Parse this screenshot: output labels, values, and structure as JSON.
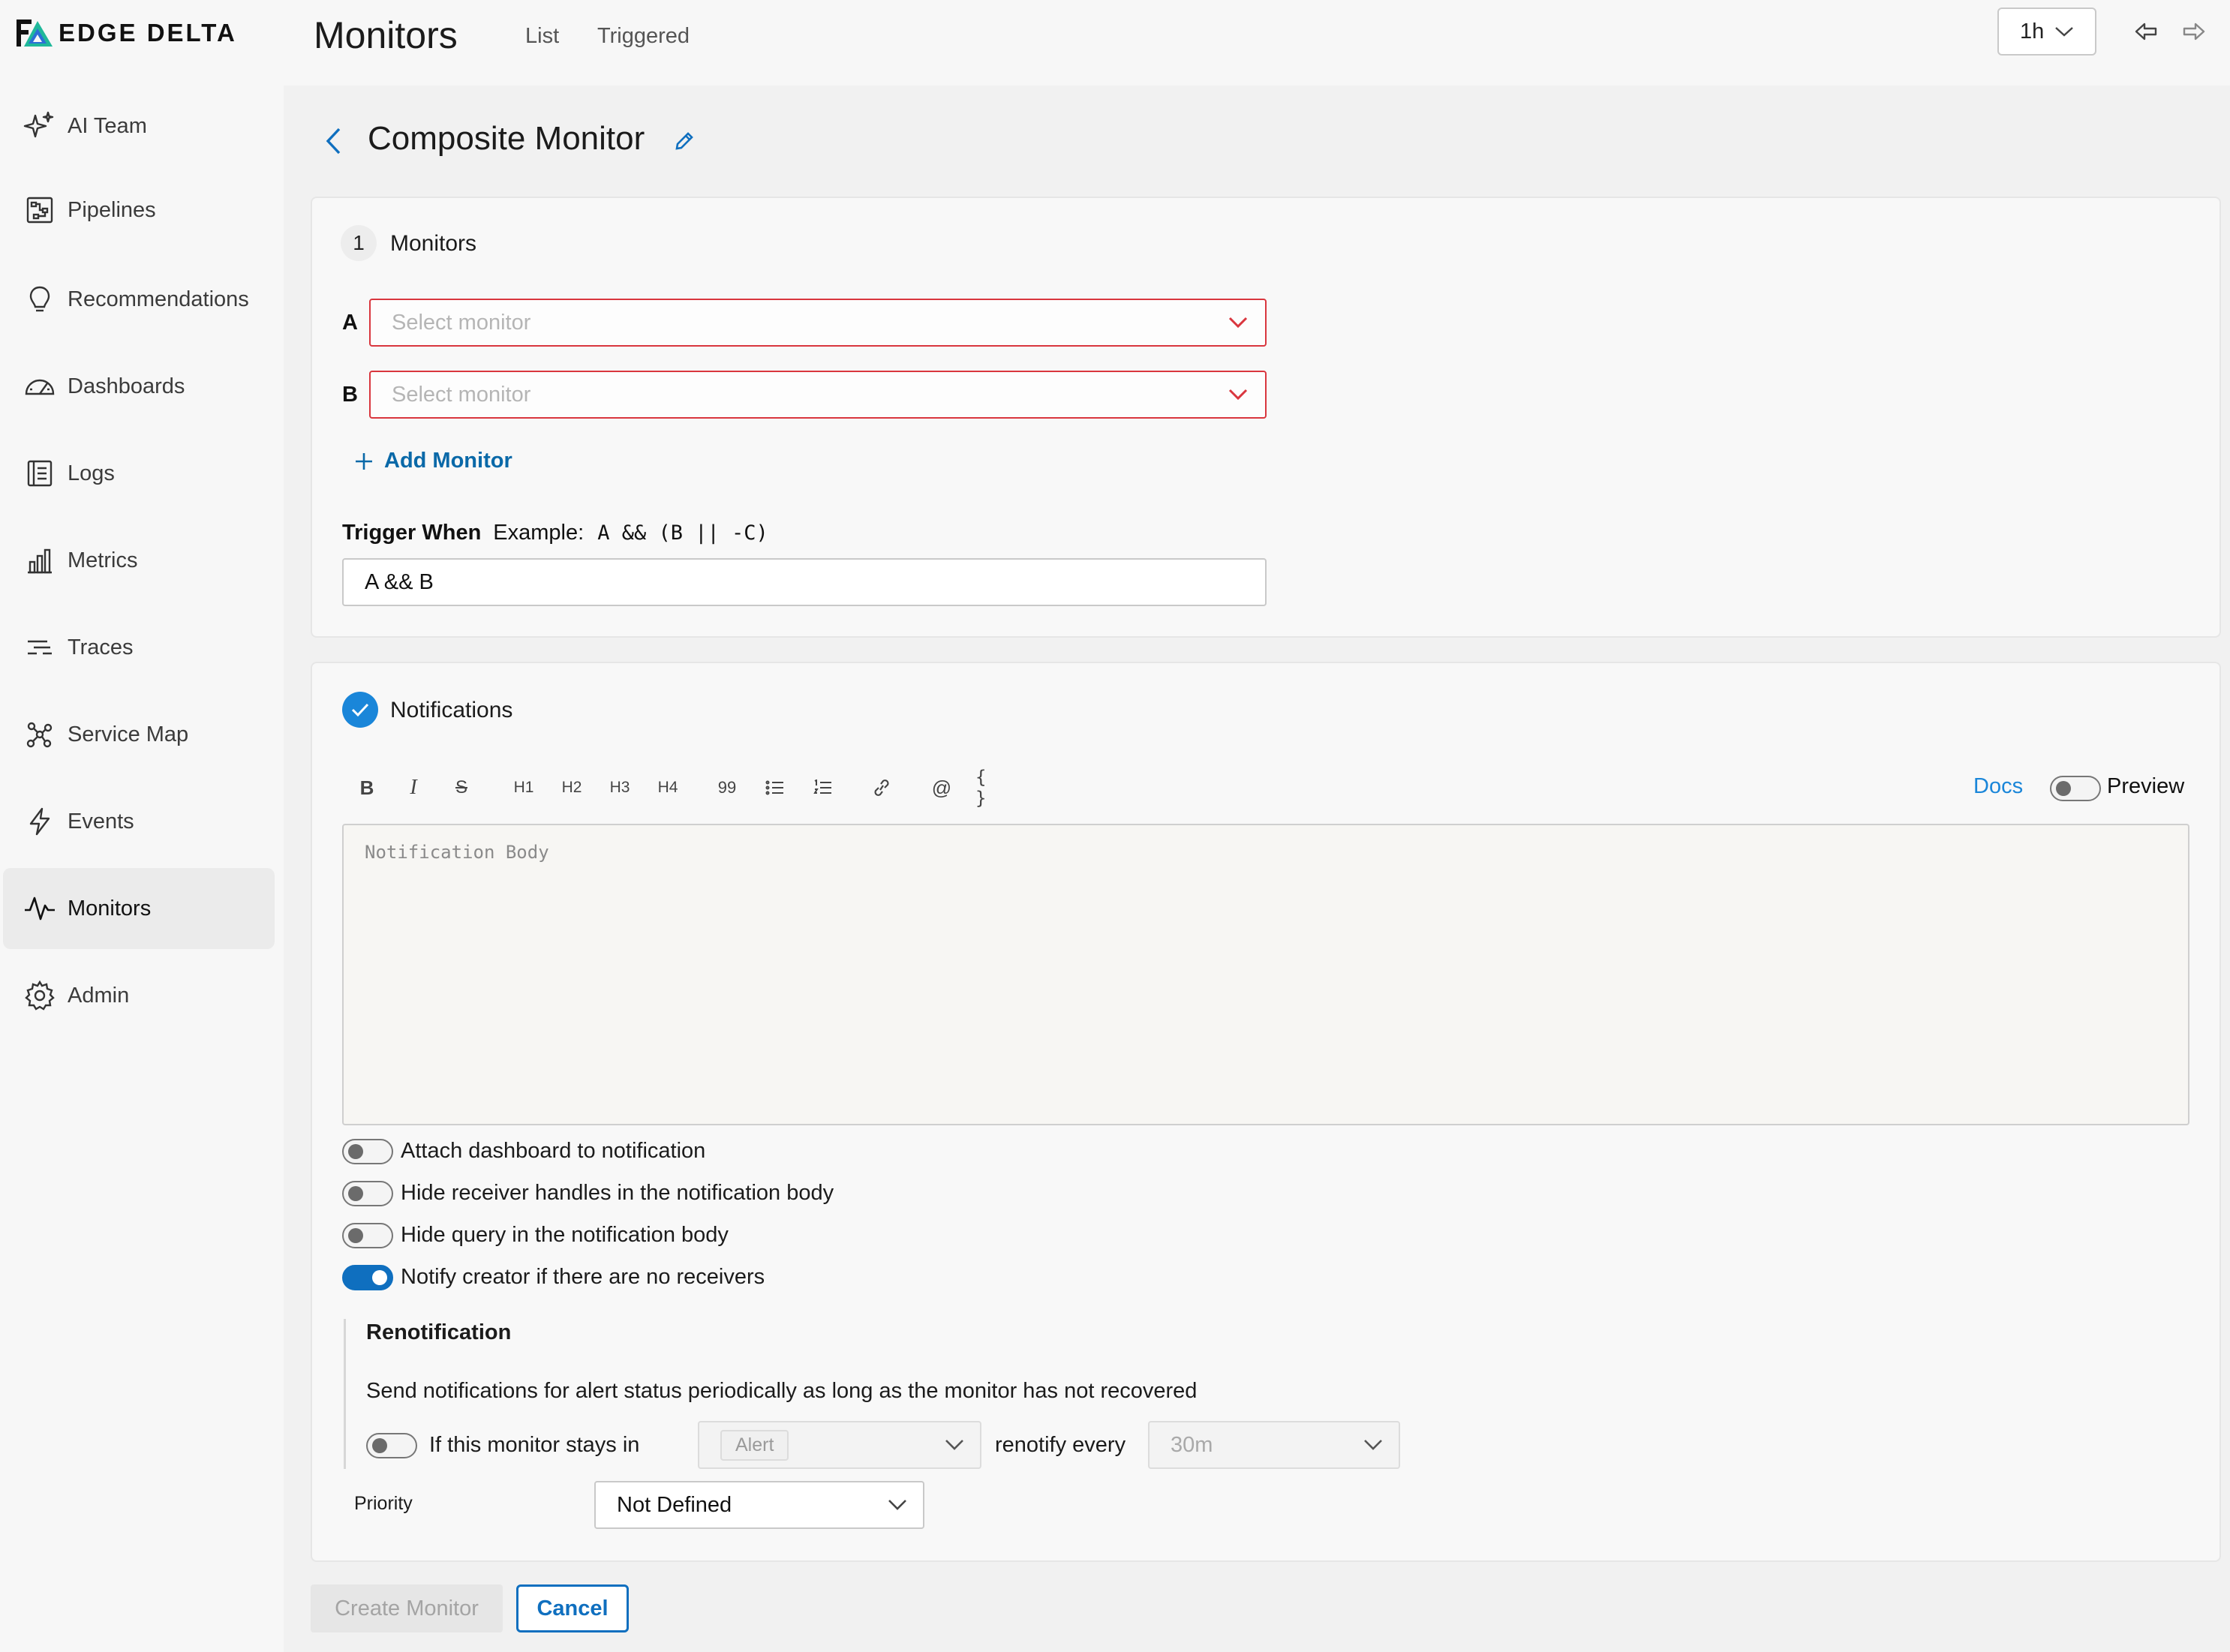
{
  "app": {
    "brand": "EDGE DELTA",
    "page_title": "Monitors",
    "tabs": [
      {
        "label": "List"
      },
      {
        "label": "Triggered"
      }
    ],
    "time_range": "1h",
    "accent_color": "#0f6fbf"
  },
  "sidebar": {
    "items": [
      {
        "label": "AI Team",
        "icon": "sparkles-icon"
      },
      {
        "label": "Pipelines",
        "icon": "pipelines-icon"
      },
      {
        "label": "Recommendations",
        "icon": "lightbulb-icon"
      },
      {
        "label": "Dashboards",
        "icon": "gauge-icon"
      },
      {
        "label": "Logs",
        "icon": "logs-icon"
      },
      {
        "label": "Metrics",
        "icon": "bar-chart-icon"
      },
      {
        "label": "Traces",
        "icon": "traces-icon"
      },
      {
        "label": "Service Map",
        "icon": "network-icon"
      },
      {
        "label": "Events",
        "icon": "lightning-icon"
      },
      {
        "label": "Monitors",
        "icon": "pulse-icon",
        "active": true
      },
      {
        "label": "Admin",
        "icon": "gear-icon"
      }
    ]
  },
  "editor_page": {
    "title": "Composite Monitor",
    "monitors_section": {
      "step": "1",
      "label": "Monitors",
      "rows": [
        {
          "letter": "A",
          "placeholder": "Select monitor"
        },
        {
          "letter": "B",
          "placeholder": "Select monitor"
        }
      ],
      "add_label": "Add Monitor",
      "trigger_label": "Trigger When",
      "example_label": "Example:",
      "example_code": "A && (B || -C)",
      "trigger_value": "A && B"
    },
    "notifications": {
      "label": "Notifications",
      "toolbar": [
        "B",
        "I",
        "S",
        "H1",
        "H2",
        "H3",
        "H4",
        "99",
        "bullet-list",
        "ordered-list",
        "link",
        "@",
        "{ }"
      ],
      "docs_label": "Docs",
      "preview_label": "Preview",
      "body_placeholder": "Notification Body",
      "options": [
        {
          "label": "Attach dashboard to notification",
          "on": false
        },
        {
          "label": "Hide receiver handles in the notification body",
          "on": false
        },
        {
          "label": "Hide query in the notification body",
          "on": false
        },
        {
          "label": "Notify creator if there are no receivers",
          "on": true
        }
      ]
    },
    "renotification": {
      "title": "Renotification",
      "description": "Send notifications for alert status periodically as long as the monitor has not recovered",
      "stays_in_label": "If this monitor stays in",
      "status_value": "Alert",
      "renotify_label": "renotify every",
      "interval_value": "30m"
    },
    "priority": {
      "label": "Priority",
      "value": "Not Defined"
    },
    "actions": {
      "create_label": "Create Monitor",
      "cancel_label": "Cancel"
    }
  }
}
